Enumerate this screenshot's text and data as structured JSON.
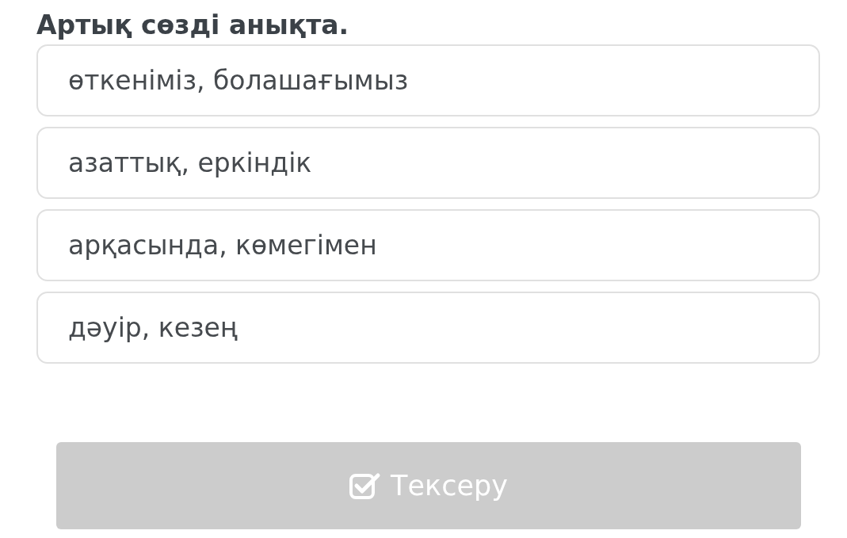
{
  "question": "Артық сөзді анықта.",
  "options": [
    {
      "label": "өткеніміз, болашағымыз",
      "selected": false
    },
    {
      "label": "азаттық, еркіндік",
      "selected": false
    },
    {
      "label": "арқасында, көмегімен",
      "selected": false
    },
    {
      "label": "дәуір, кезең",
      "selected": false
    }
  ],
  "check_button": {
    "label": "Тексеру",
    "disabled": true
  }
}
